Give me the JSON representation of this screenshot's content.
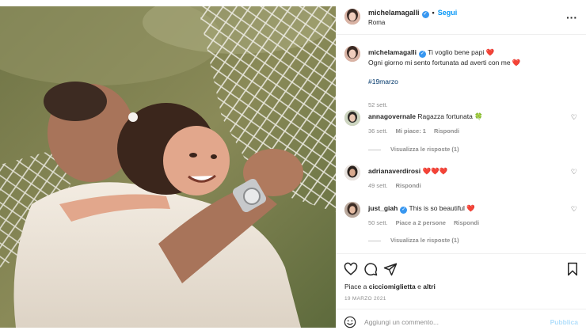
{
  "post": {
    "username": "michelamagalli",
    "follow_label": "Segui",
    "separator": "•",
    "location": "Roma",
    "more_label": "···"
  },
  "caption": {
    "username": "michelamagalli",
    "line1": "Ti voglio bene papi",
    "line1_emoji": "❤️",
    "line2": "Ogni giorno mi sento fortunata ad averti con me",
    "line2_emoji": "❤️",
    "hashtag": "#19marzo",
    "time": "52 sett."
  },
  "comments": [
    {
      "username": "annagovernale",
      "text": "Ragazza fortunata",
      "emoji": "🍀",
      "time": "36 sett.",
      "likes": "Mi piace: 1",
      "reply": "Rispondi",
      "view_replies": "Visualizza le risposte (1)"
    },
    {
      "username": "adrianaverdirosi",
      "text": "❤️❤️❤️",
      "time": "49 sett.",
      "reply": "Rispondi"
    },
    {
      "username": "just_giah",
      "text": "This is so beautiful",
      "emoji": "❤️",
      "time": "50 sett.",
      "likes": "Piace a 2 persone",
      "reply": "Rispondi",
      "view_replies": "Visualizza le risposte (1)"
    }
  ],
  "actions": {
    "likes_prefix": "Piace a",
    "likes_user": "cicciomiglietta",
    "likes_conj": "e",
    "likes_others": "altri",
    "date": "19 MARZO 2021"
  },
  "add_comment": {
    "placeholder": "Aggiungi un commento...",
    "publish_label": "Pubblica"
  },
  "colors": {
    "link_blue": "#0095f6",
    "verified_blue": "#3897f0",
    "heart_red": "#ed4956",
    "muted_gray": "#8e8e8e"
  },
  "icons": [
    "heart-icon",
    "comment-icon",
    "share-icon",
    "bookmark-icon",
    "emoji-icon",
    "verified-icon",
    "more-icon"
  ]
}
